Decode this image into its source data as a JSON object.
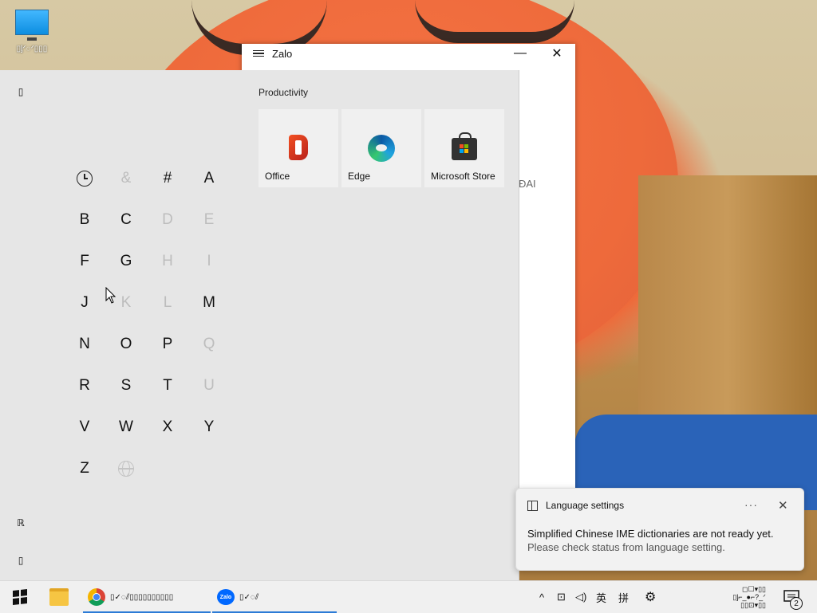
{
  "desktop": {
    "icon_label": "▯ᶅᐟ◌ᐟ▯▯▯"
  },
  "zalo": {
    "title": "Zalo",
    "minimize": "—",
    "close": "✕",
    "partial_text": "ĐAI"
  },
  "start_menu": {
    "rail": {
      "top_icon": "▯",
      "user_icon": "ℝ",
      "bottom_icon": "▯"
    },
    "letters": [
      {
        "label": "",
        "dim": false,
        "icon": "clock-icon"
      },
      {
        "label": "&",
        "dim": true
      },
      {
        "label": "#",
        "dim": false
      },
      {
        "label": "A",
        "dim": false
      },
      {
        "label": "B",
        "dim": false
      },
      {
        "label": "C",
        "dim": false
      },
      {
        "label": "D",
        "dim": true
      },
      {
        "label": "E",
        "dim": true
      },
      {
        "label": "F",
        "dim": false
      },
      {
        "label": "G",
        "dim": false
      },
      {
        "label": "H",
        "dim": true
      },
      {
        "label": "I",
        "dim": true
      },
      {
        "label": "J",
        "dim": false
      },
      {
        "label": "K",
        "dim": true
      },
      {
        "label": "L",
        "dim": true
      },
      {
        "label": "M",
        "dim": false
      },
      {
        "label": "N",
        "dim": false
      },
      {
        "label": "O",
        "dim": false
      },
      {
        "label": "P",
        "dim": false
      },
      {
        "label": "Q",
        "dim": true
      },
      {
        "label": "R",
        "dim": false
      },
      {
        "label": "S",
        "dim": false
      },
      {
        "label": "T",
        "dim": false
      },
      {
        "label": "U",
        "dim": true
      },
      {
        "label": "V",
        "dim": false
      },
      {
        "label": "W",
        "dim": false
      },
      {
        "label": "X",
        "dim": false
      },
      {
        "label": "Y",
        "dim": false
      },
      {
        "label": "Z",
        "dim": false
      },
      {
        "label": "",
        "dim": true,
        "icon": "globe-icon"
      }
    ],
    "group_title": "Productivity",
    "tiles": [
      {
        "label": "Office",
        "icon": "office-icon"
      },
      {
        "label": "Edge",
        "icon": "edge-icon"
      },
      {
        "label": "Microsoft Store",
        "icon": "store-icon"
      }
    ]
  },
  "toast": {
    "title": "Language settings",
    "more": "···",
    "close": "✕",
    "line1": "Simplified Chinese IME dictionaries are not ready yet.",
    "line2": "Please check status from language setting."
  },
  "taskbar": {
    "chrome_label": "▯✓◌⫽▯▯▯▯▯▯▯▯▯▯",
    "zalo_label": "▯✓◌⫽",
    "zalo_icon_text": "Zalo",
    "tray_chevron": "^",
    "tray_network": "⊡",
    "tray_volume": "◁)",
    "ime_mode": "英",
    "ime_pinyin": "拼",
    "tray_settings": "⚙",
    "clock_top": "◻☐▾▯▯",
    "clock_row1": "▯ᶅ⌐_●⌐?_ᐟ",
    "clock_row2": "▯▯⊡▾▯▯",
    "notifications_count": "2"
  },
  "colors": {
    "accent": "#2c7bd6",
    "start_bg": "#e6e6e6",
    "tile_bg": "#f0f0f0"
  }
}
